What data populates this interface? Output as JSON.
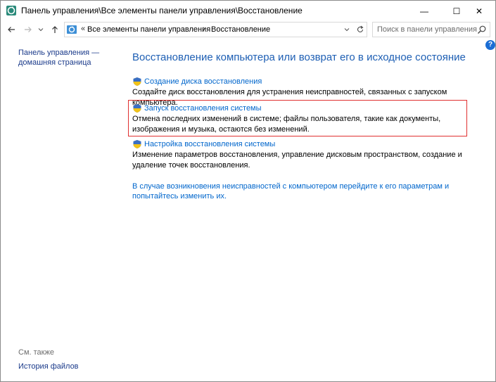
{
  "window": {
    "title": "Панель управления\\Все элементы панели управления\\Восстановление",
    "minimize_symbol": "—",
    "maximize_symbol": "☐",
    "close_symbol": "✕"
  },
  "nav": {
    "back_icon": "back-arrow-icon",
    "forward_icon": "forward-arrow-icon",
    "recent_icon": "chevron-down-icon",
    "up_icon": "up-arrow-icon"
  },
  "address": {
    "overflow": "«",
    "crumbs": [
      {
        "label": "Все элементы панели управления"
      },
      {
        "label": "Восстановление"
      }
    ],
    "separator": "›"
  },
  "search": {
    "placeholder": "Поиск в панели управления"
  },
  "help": {
    "label": "?"
  },
  "sidebar": {
    "home_link": "Панель управления — домашняя страница",
    "see_also": "См. также",
    "history_link": "История файлов"
  },
  "main": {
    "title": "Восстановление компьютера или возврат его в исходное состояние",
    "items": [
      {
        "link": "Создание диска восстановления",
        "desc": "Создайте диск восстановления для устранения неисправностей, связанных с запуском компьютера."
      },
      {
        "link": "Запуск восстановления системы",
        "desc": "Отмена последних изменений в системе; файлы пользователя, такие как документы, изображения и музыка, остаются без изменений."
      },
      {
        "link": "Настройка восстановления системы",
        "desc": "Изменение параметров восстановления, управление дисковым пространством, создание и удаление точек восстановления."
      }
    ],
    "bottom_link": "В случае возникновения неисправностей с компьютером перейдите к его параметрам и попытайтесь изменить их."
  },
  "colors": {
    "link": "#0066cc",
    "title": "#1e5fb4",
    "highlight_border": "#e03030"
  }
}
